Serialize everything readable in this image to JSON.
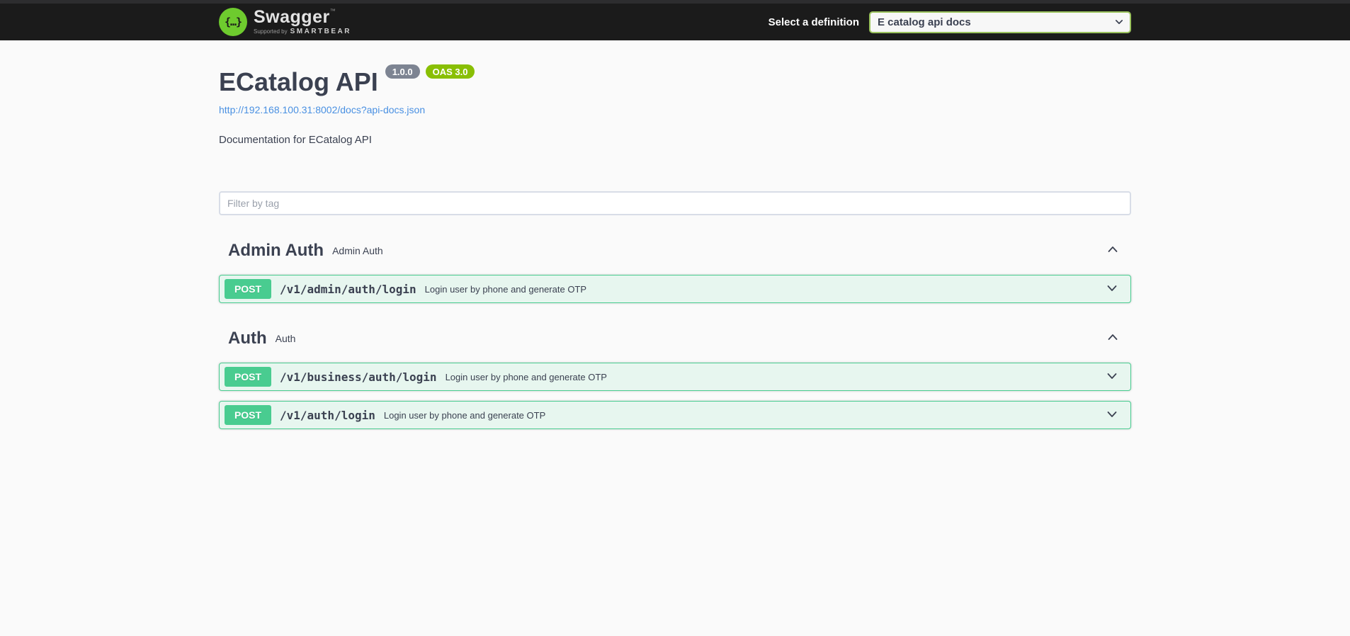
{
  "header": {
    "logo": {
      "icon_glyph": "{…}",
      "brand": "Swagger",
      "trademark": "™",
      "tagline_prefix": "Supported by",
      "tagline_brand": "SMARTBEAR"
    },
    "select_label": "Select a definition",
    "selected_definition": "E catalog api docs"
  },
  "info": {
    "title": "ECatalog API",
    "version_badge": "1.0.0",
    "oas_badge": "OAS 3.0",
    "spec_url": "http://192.168.100.31:8002/docs?api-docs.json",
    "description": "Documentation for ECatalog API"
  },
  "filter": {
    "placeholder": "Filter by tag"
  },
  "sections": [
    {
      "name": "Admin Auth",
      "description": "Admin Auth",
      "expanded": true,
      "operations": [
        {
          "method": "POST",
          "path": "/v1/admin/auth/login",
          "summary": "Login user by phone and generate OTP"
        }
      ]
    },
    {
      "name": "Auth",
      "description": "Auth",
      "expanded": true,
      "operations": [
        {
          "method": "POST",
          "path": "/v1/business/auth/login",
          "summary": "Login user by phone and generate OTP"
        },
        {
          "method": "POST",
          "path": "/v1/auth/login",
          "summary": "Login user by phone and generate OTP"
        }
      ]
    }
  ],
  "colors": {
    "topbar_bg": "#1b1b1b",
    "page_bg": "#fafafa",
    "text": "#3b4151",
    "link": "#4990e2",
    "method_post": "#49cc90",
    "operation_row_bg": "#e7f6ef",
    "version_badge_bg": "#7d8492",
    "oas_badge_bg": "#89bf04",
    "logo_green": "#6ecb2e",
    "select_border": "#9bc35e"
  }
}
